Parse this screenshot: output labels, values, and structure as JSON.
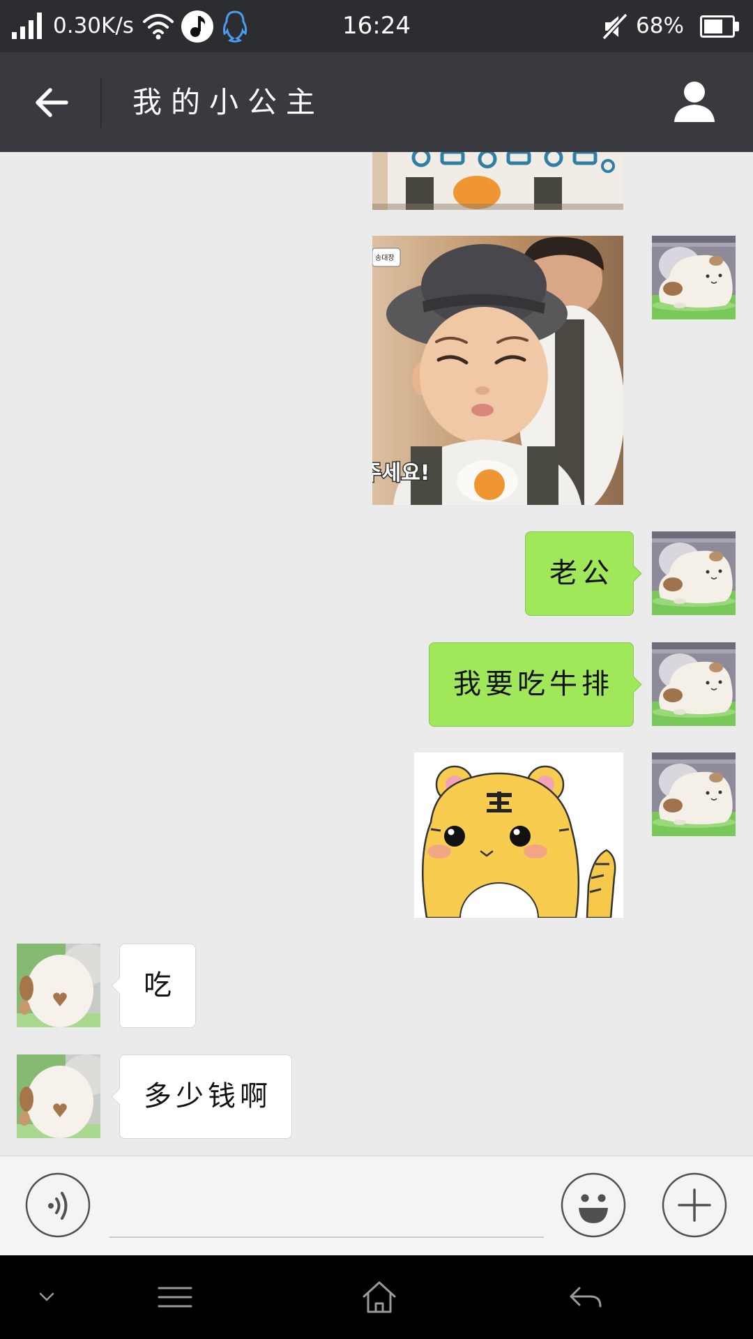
{
  "status_bar": {
    "network_speed": "0.30K/s",
    "time": "16:24",
    "battery_text": "68%",
    "battery_level": 0.68,
    "icons": {
      "signal": "signal-bars-icon",
      "wifi": "wifi-icon",
      "music": "music-app-icon",
      "qq": "qq-penguin-icon",
      "mute": "mute-icon",
      "battery": "battery-icon"
    }
  },
  "header": {
    "title": "我的小公主",
    "icons": {
      "back": "arrow-left-icon",
      "profile": "person-icon"
    }
  },
  "chat": {
    "photo": {
      "label": "송대장",
      "caption": "주세요!"
    },
    "sent": [
      {
        "text": "老公"
      },
      {
        "text": "我要吃牛排"
      }
    ],
    "received": [
      {
        "text": "吃"
      },
      {
        "text": "多少钱啊"
      }
    ]
  },
  "input_bar": {
    "icons": {
      "voice": "voice-wave-icon",
      "emoji": "smiley-icon",
      "more": "plus-icon"
    }
  },
  "nav_bar": {
    "icons": {
      "collapse": "chevron-down-icon",
      "menu": "menu-lines-icon",
      "home": "home-icon",
      "back": "return-arrow-icon"
    }
  },
  "colors": {
    "status_bar_bg": "#2c2d31",
    "header_bg": "#393a3f",
    "chat_bg": "#ebebeb",
    "sent_bubble": "#a0e759",
    "received_bubble": "#ffffff",
    "input_bar_bg": "#f4f4f6",
    "nav_bar_bg": "#000000"
  }
}
